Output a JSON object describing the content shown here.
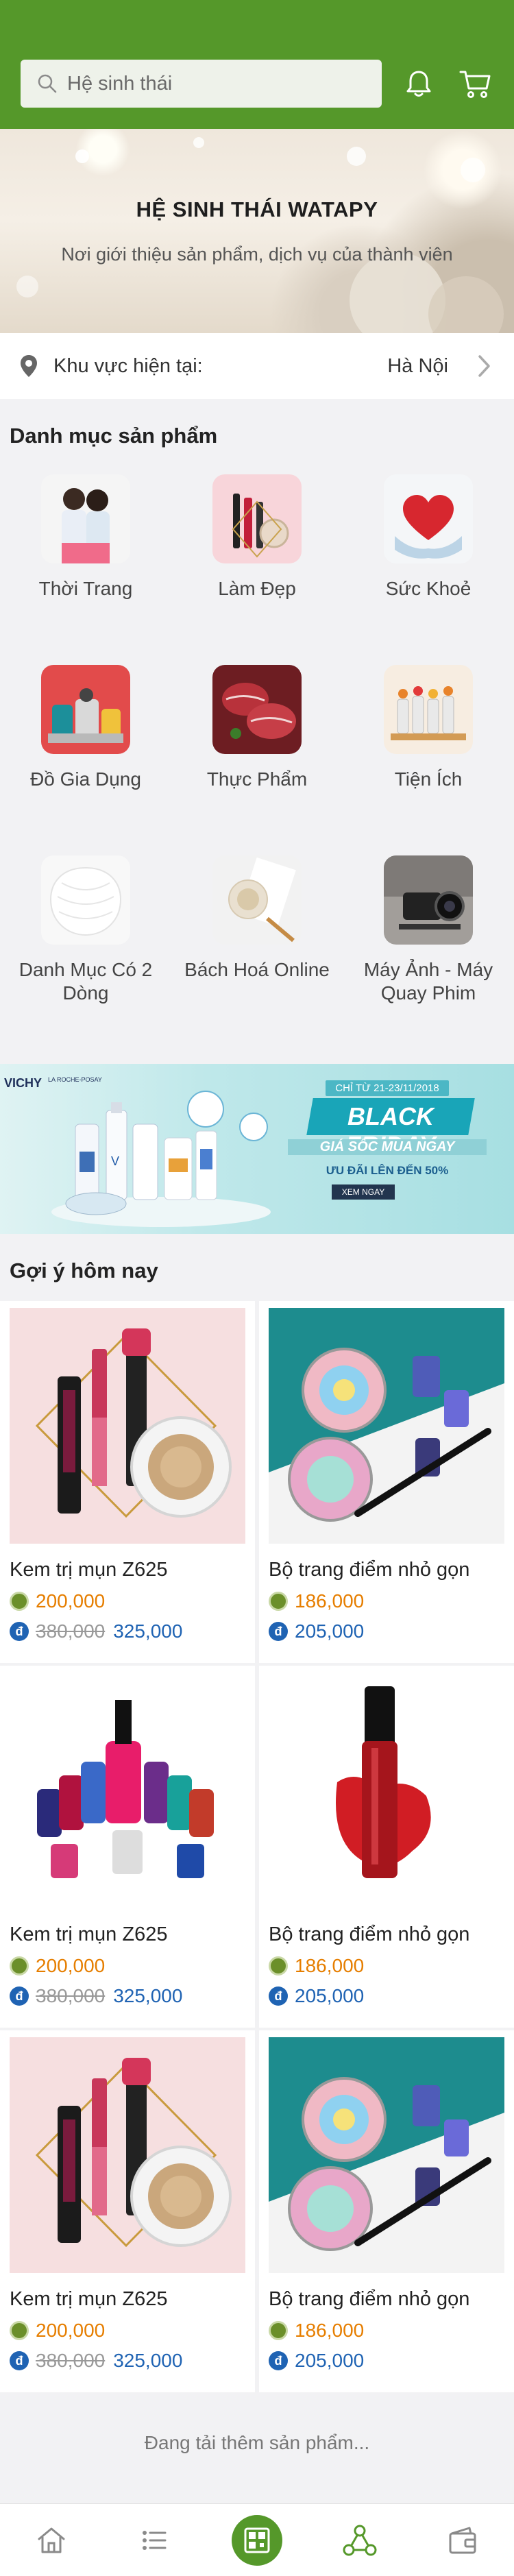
{
  "search": {
    "placeholder": "Hệ sinh thái"
  },
  "header": {
    "icons": [
      "search-icon",
      "bell-icon",
      "cart-icon"
    ]
  },
  "hero": {
    "title": "HỆ SINH THÁI WATAPY",
    "subtitle": "Nơi giới thiệu sản phẩm, dịch vụ của thành viên"
  },
  "location": {
    "label": "Khu vực hiện tại:",
    "value": "Hà Nội"
  },
  "categories": {
    "title": "Danh mục sản phẩm",
    "items": [
      {
        "label": "Thời Trang"
      },
      {
        "label": "Làm Đẹp"
      },
      {
        "label": "Sức Khoẻ"
      },
      {
        "label": "Đồ Gia Dụng"
      },
      {
        "label": "Thực Phẩm"
      },
      {
        "label": "Tiện Ích"
      },
      {
        "label": "Danh Mục Có 2 Dòng"
      },
      {
        "label": "Bách Hoá Online"
      },
      {
        "label": "Máy Ảnh - Máy Quay Phim"
      }
    ]
  },
  "promo": {
    "brand": "VICHY",
    "brand2": "LA ROCHE-POSAY",
    "date": "CHỈ TỪ 21-23/11/2018",
    "headline": "BLACK FRIDAY",
    "tagline": "GIÁ SỐC MUA NGAY",
    "discount": "ƯU ĐÃI LÊN ĐẾN 50%",
    "cta": "XEM NGAY"
  },
  "suggestions": {
    "title": "Gợi ý hôm nay",
    "products": [
      {
        "name": "Kem trị mụn Z625",
        "price_w": "200,000",
        "old_price": "380,000",
        "price_d": "325,000"
      },
      {
        "name": "Bộ trang điểm nhỏ gọn",
        "price_w": "186,000",
        "old_price": "",
        "price_d": "205,000"
      },
      {
        "name": "Kem trị mụn Z625",
        "price_w": "200,000",
        "old_price": "380,000",
        "price_d": "325,000"
      },
      {
        "name": "Bộ trang điểm nhỏ gọn",
        "price_w": "186,000",
        "old_price": "",
        "price_d": "205,000"
      },
      {
        "name": "Kem trị mụn Z625",
        "price_w": "200,000",
        "old_price": "380,000",
        "price_d": "325,000"
      },
      {
        "name": "Bộ trang điểm nhỏ gọn",
        "price_w": "186,000",
        "old_price": "",
        "price_d": "205,000"
      }
    ],
    "currency_symbol": "đ"
  },
  "loading": "Đang tải thêm sản phẩm...",
  "nav": {
    "items": [
      "home-icon",
      "list-icon",
      "scan-icon",
      "network-icon",
      "wallet-icon"
    ],
    "active_color": "#55982a"
  },
  "colors": {
    "brand": "#55982a",
    "price_w": "#e67e00",
    "price_d": "#1f63b3"
  }
}
